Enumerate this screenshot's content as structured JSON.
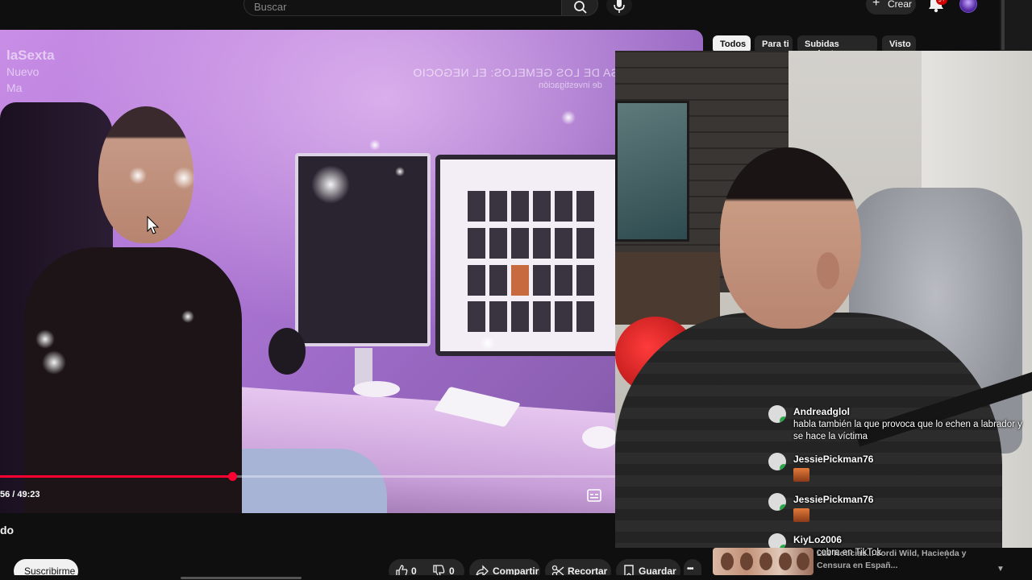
{
  "header": {
    "search_placeholder": "Buscar",
    "create_label": "Crear",
    "notifications_badge": "9+"
  },
  "filter_chips": [
    "Todos",
    "Para ti",
    "Subidas recientes",
    "Visto"
  ],
  "video": {
    "watermark_left_title": "laSexta",
    "watermark_left_line2": "Nuevo",
    "watermark_left_line3": "Ma",
    "watermark_right_title": "CASA DE LOS GEMELOS: EL NEGOCIO",
    "watermark_right_sub": "de investigación",
    "time": "56 / 49:23",
    "progress": 0.377
  },
  "below_video": {
    "title_fragment": "do",
    "subscribe_label": "Suscribirme",
    "like_count": "0",
    "dislike_count": "0",
    "share_label": "Compartir",
    "clip_label": "Recortar",
    "save_label": "Guardar",
    "more_label": "•••"
  },
  "chat": [
    {
      "user": "Andreadglol",
      "text": "habla también la que provoca que lo echen a labrador y se hace la víctima",
      "avatar_color": "#e6e6e6"
    },
    {
      "user": "JessiePickman76",
      "text": "",
      "emote": true,
      "avatar_color": "#d8d8d8"
    },
    {
      "user": "JessiePickman76",
      "text": "",
      "emote": true,
      "avatar_color": "#d8d8d8"
    },
    {
      "user": "KiyLo2006",
      "text": "Si se cobra en TikTok",
      "avatar_color": "#e6e6e6"
    }
  ],
  "recommendation": {
    "title": "Las Noticias... Jordi Wild, Hacienda y Censura en Españ...",
    "more_label": "⋮"
  },
  "colors": {
    "background": "#0f0f0f",
    "progress": "#ff0033",
    "chip_active_bg": "#f1f1f1",
    "chip_bg": "#272727"
  }
}
